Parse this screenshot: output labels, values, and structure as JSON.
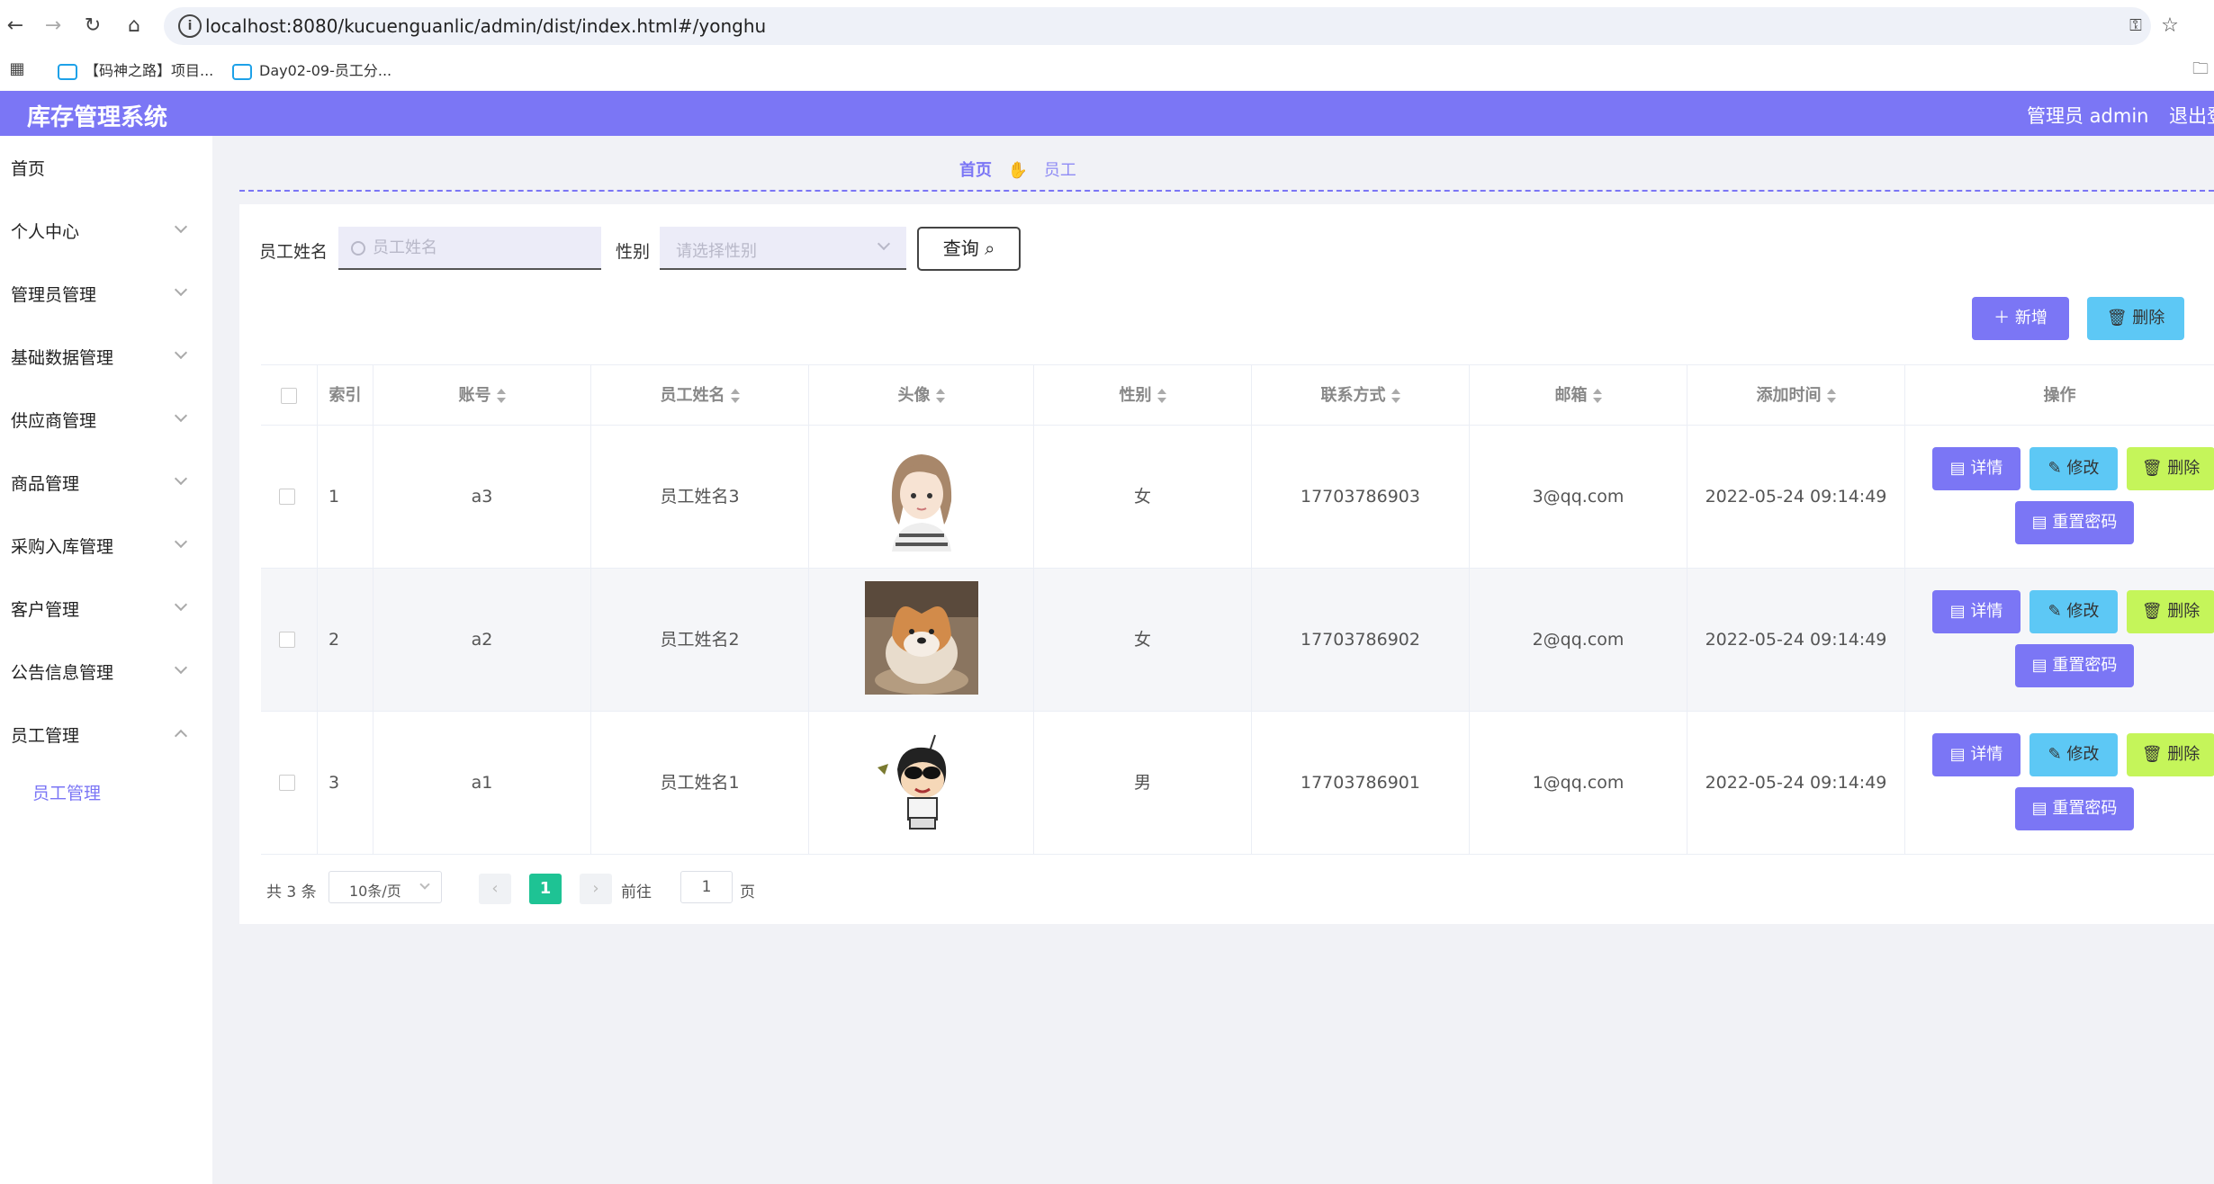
{
  "browser": {
    "url": "localhost:8080/kucuenguanlic/admin/dist/index.html#/yonghu",
    "bookmarks": [
      "【码神之路】项目...",
      "Day02-09-员工分..."
    ]
  },
  "header": {
    "title": "库存管理系统",
    "user": "管理员 admin",
    "logout": "退出登"
  },
  "sidebar": {
    "items": [
      {
        "label": "首页",
        "arrow": false
      },
      {
        "label": "个人中心",
        "arrow": true
      },
      {
        "label": "管理员管理",
        "arrow": true
      },
      {
        "label": "基础数据管理",
        "arrow": true
      },
      {
        "label": "供应商管理",
        "arrow": true
      },
      {
        "label": "商品管理",
        "arrow": true
      },
      {
        "label": "采购入库管理",
        "arrow": true
      },
      {
        "label": "客户管理",
        "arrow": true
      },
      {
        "label": "公告信息管理",
        "arrow": true
      },
      {
        "label": "员工管理",
        "arrow": true,
        "expanded": true
      }
    ],
    "sub_item": "员工管理"
  },
  "breadcrumb": {
    "home": "首页",
    "current": "员工"
  },
  "search": {
    "name_label": "员工姓名",
    "name_placeholder": "员工姓名",
    "gender_label": "性别",
    "gender_placeholder": "请选择性别",
    "query_button": "查询"
  },
  "actions": {
    "add": "新增",
    "delete": "删除"
  },
  "table": {
    "headers": [
      "索引",
      "账号",
      "员工姓名",
      "头像",
      "性别",
      "联系方式",
      "邮箱",
      "添加时间",
      "操作"
    ],
    "rows": [
      {
        "index": "1",
        "account": "a3",
        "name": "员工姓名3",
        "avatar": "girl-avatar",
        "gender": "女",
        "phone": "17703786903",
        "email": "3@qq.com",
        "time": "2022-05-24 09:14:49"
      },
      {
        "index": "2",
        "account": "a2",
        "name": "员工姓名2",
        "avatar": "shiba-dog-photo",
        "gender": "女",
        "phone": "17703786902",
        "email": "2@qq.com",
        "time": "2022-05-24 09:14:49"
      },
      {
        "index": "3",
        "account": "a1",
        "name": "员工姓名1",
        "avatar": "cartoon-boy-avatar",
        "gender": "男",
        "phone": "17703786901",
        "email": "1@qq.com",
        "time": "2022-05-24 09:14:49"
      }
    ],
    "row_buttons": {
      "detail": "详情",
      "edit": "修改",
      "delete": "删除",
      "reset": "重置密码"
    }
  },
  "pagination": {
    "total": "共 3 条",
    "page_size": "10条/页",
    "current_page": "1",
    "goto_prefix": "前往",
    "goto_value": "1",
    "goto_suffix": "页"
  },
  "colors": {
    "primary": "#7b76f5",
    "info": "#5dc8f5",
    "lime": "#c5f55a",
    "pager": "#1ec394"
  }
}
